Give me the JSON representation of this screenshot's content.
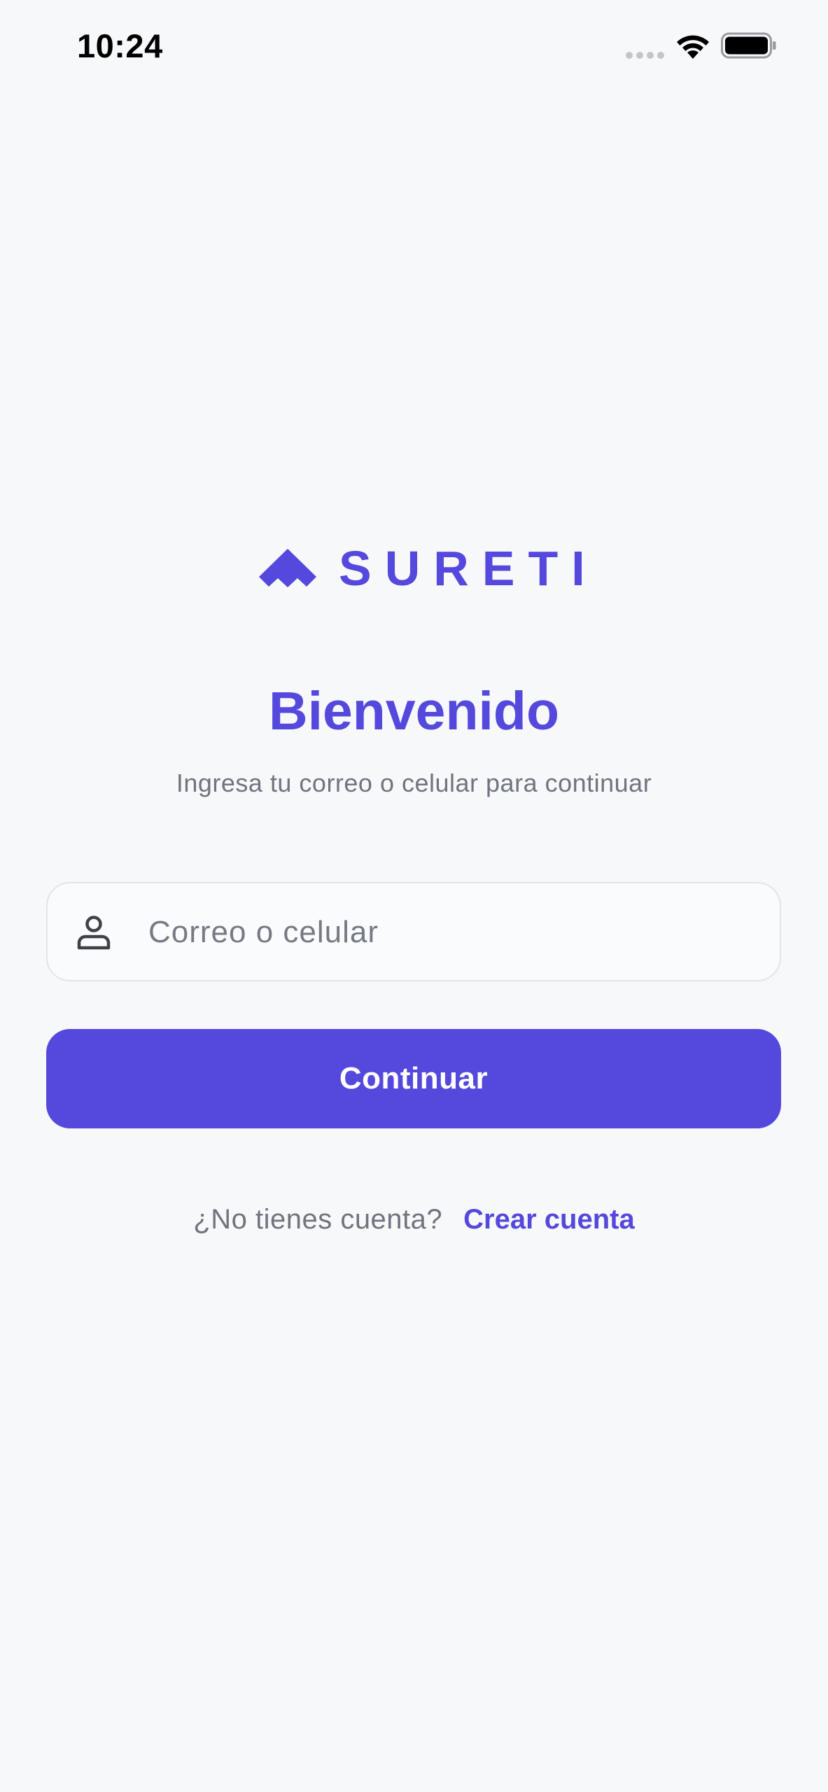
{
  "status_bar": {
    "time": "10:24",
    "icons": [
      "signal-dots-icon",
      "wifi-icon",
      "battery-icon"
    ]
  },
  "brand": {
    "name": "SURETI",
    "logo_icon": "sureti-logo-mark",
    "color": "#5548dd"
  },
  "login": {
    "title": "Bienvenido",
    "subtitle": "Ingresa tu correo o celular para continuar",
    "input": {
      "icon": "user-icon",
      "placeholder": "Correo o celular",
      "value": ""
    },
    "continue_label": "Continuar"
  },
  "signup": {
    "prompt": "¿No tienes cuenta?",
    "link_label": "Crear cuenta"
  },
  "colors": {
    "accent": "#5548dd",
    "background": "#f7f8fa",
    "muted_text": "#70747f"
  }
}
